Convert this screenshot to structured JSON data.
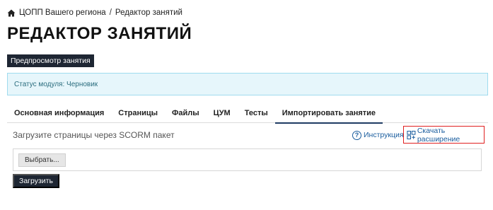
{
  "breadcrumb": {
    "home_icon": "home-icon",
    "items": [
      "ЦОПП Вашего региона",
      "Редактор занятий"
    ],
    "separator": "/"
  },
  "page": {
    "title": "РЕДАКТОР ЗАНЯТИЙ",
    "preview_button": "Предпросмотр занятия"
  },
  "status": {
    "text": "Статус модуля: Черновик"
  },
  "tabs": [
    {
      "label": "Основная информация",
      "active": false
    },
    {
      "label": "Страницы",
      "active": false
    },
    {
      "label": "Файлы",
      "active": false
    },
    {
      "label": "ЦУМ",
      "active": false
    },
    {
      "label": "Тесты",
      "active": false
    },
    {
      "label": "Импортировать занятие",
      "active": true
    }
  ],
  "upload": {
    "title": "Загрузите страницы через SCORM пакет",
    "help_link": "Инструкция",
    "help_icon": "question-circle-icon",
    "download_link": "Скачать расширение",
    "download_icon": "extension-icon",
    "choose_button": "Выбрать...",
    "submit_button": "Загрузить"
  },
  "colors": {
    "dark_button": "#1e2633",
    "link": "#1a5d9e",
    "status_bg": "#e6f6fb",
    "highlight_border": "#e02020",
    "active_tab_underline": "#1f3b63"
  }
}
